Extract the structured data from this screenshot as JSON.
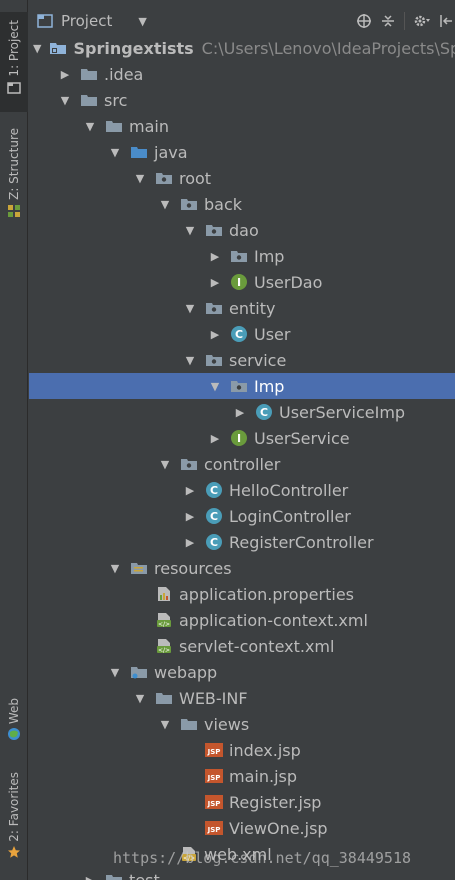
{
  "header": {
    "title": "Project"
  },
  "left_strip": {
    "project_tab": "1: Project",
    "structure_tab": "Z: Structure",
    "web_tab": "Web",
    "favorites_tab": "2: Favorites"
  },
  "tree": [
    {
      "label": "Springextists",
      "path": "C:\\Users\\Lenovo\\IdeaProjects\\Spri",
      "depth": 0,
      "expanded": true,
      "icon": "module-folder-icon",
      "bold": true
    },
    {
      "label": ".idea",
      "depth": 1,
      "expanded": false,
      "icon": "folder-icon"
    },
    {
      "label": "src",
      "depth": 1,
      "expanded": true,
      "icon": "folder-icon"
    },
    {
      "label": "main",
      "depth": 2,
      "expanded": true,
      "icon": "folder-icon"
    },
    {
      "label": "java",
      "depth": 3,
      "expanded": true,
      "icon": "source-folder-icon"
    },
    {
      "label": "root",
      "depth": 4,
      "expanded": true,
      "icon": "package-icon"
    },
    {
      "label": "back",
      "depth": 5,
      "expanded": true,
      "icon": "package-icon"
    },
    {
      "label": "dao",
      "depth": 6,
      "expanded": true,
      "icon": "package-icon"
    },
    {
      "label": "Imp",
      "depth": 7,
      "expanded": false,
      "icon": "package-icon"
    },
    {
      "label": "UserDao",
      "depth": 7,
      "expanded": false,
      "icon": "interface-icon"
    },
    {
      "label": "entity",
      "depth": 6,
      "expanded": true,
      "icon": "package-icon"
    },
    {
      "label": "User",
      "depth": 7,
      "expanded": false,
      "icon": "class-icon"
    },
    {
      "label": "service",
      "depth": 6,
      "expanded": true,
      "icon": "package-icon"
    },
    {
      "label": "Imp",
      "depth": 7,
      "expanded": true,
      "icon": "package-icon",
      "selected": true
    },
    {
      "label": "UserServiceImp",
      "depth": 8,
      "expanded": false,
      "icon": "class-icon"
    },
    {
      "label": "UserService",
      "depth": 7,
      "expanded": false,
      "icon": "interface-icon"
    },
    {
      "label": "controller",
      "depth": 5,
      "expanded": true,
      "icon": "package-icon"
    },
    {
      "label": "HelloController",
      "depth": 6,
      "expanded": false,
      "icon": "class-icon"
    },
    {
      "label": "LoginController",
      "depth": 6,
      "expanded": false,
      "icon": "class-icon"
    },
    {
      "label": "RegisterController",
      "depth": 6,
      "expanded": false,
      "icon": "class-icon"
    },
    {
      "label": "resources",
      "depth": 3,
      "expanded": true,
      "icon": "resources-folder-icon"
    },
    {
      "label": "application.properties",
      "depth": 4,
      "icon": "properties-file-icon"
    },
    {
      "label": "application-context.xml",
      "depth": 4,
      "icon": "spring-xml-icon"
    },
    {
      "label": "servlet-context.xml",
      "depth": 4,
      "icon": "spring-xml-icon"
    },
    {
      "label": "webapp",
      "depth": 3,
      "expanded": true,
      "icon": "web-folder-icon"
    },
    {
      "label": "WEB-INF",
      "depth": 4,
      "expanded": true,
      "icon": "folder-icon"
    },
    {
      "label": "views",
      "depth": 5,
      "expanded": true,
      "icon": "folder-icon"
    },
    {
      "label": "index.jsp",
      "depth": 6,
      "icon": "jsp-file-icon"
    },
    {
      "label": "main.jsp",
      "depth": 6,
      "icon": "jsp-file-icon"
    },
    {
      "label": "Register.jsp",
      "depth": 6,
      "icon": "jsp-file-icon"
    },
    {
      "label": "ViewOne.jsp",
      "depth": 6,
      "icon": "jsp-file-icon"
    },
    {
      "label": "web.xml",
      "depth": 5,
      "icon": "web-xml-icon"
    },
    {
      "label": "test",
      "depth": 2,
      "expanded": false,
      "icon": "folder-icon"
    }
  ],
  "watermark": "https://blog.csdn.net/qq_38449518",
  "colors": {
    "background": "#3c3f41",
    "selection": "#4b6eaf",
    "text": "#bbbbbb",
    "path": "#8a8a8a",
    "class": "#4a9db8",
    "interface": "#6a9b3c",
    "jsp": "#c4562d"
  }
}
